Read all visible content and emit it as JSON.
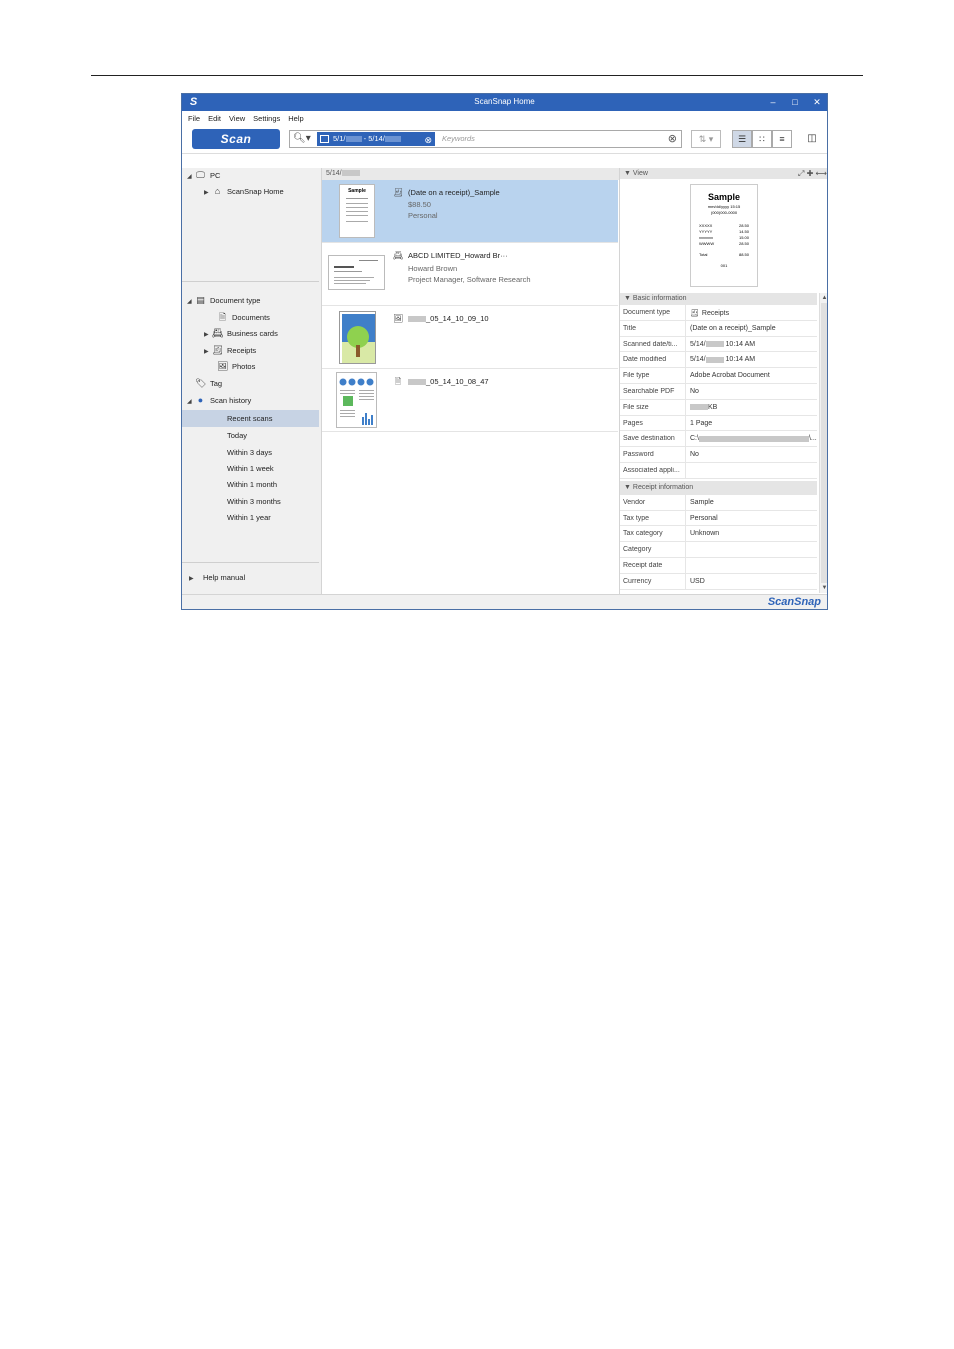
{
  "window": {
    "title": "ScanSnap Home",
    "controls": {
      "minimize": "–",
      "maximize": "□",
      "close": "✕"
    }
  },
  "menu": [
    "File",
    "Edit",
    "View",
    "Settings",
    "Help"
  ],
  "toolbar": {
    "scan_label": "Scan",
    "date_from": "5/1/",
    "date_sep": " - ",
    "date_to": "5/14/",
    "keywords_placeholder": "Keywords"
  },
  "left_tree": {
    "pc": "PC",
    "scansnap_home": "ScanSnap Home",
    "document_type": "Document type",
    "documents": "Documents",
    "business_cards": "Business cards",
    "receipts": "Receipts",
    "photos": "Photos",
    "tag": "Tag",
    "scan_history": "Scan history",
    "history_items": [
      "Recent scans",
      "Today",
      "Within 3 days",
      "Within 1 week",
      "Within 1 month",
      "Within 3 months",
      "Within 1 year"
    ],
    "selected_history": "Recent scans",
    "help_manual": "Help manual"
  },
  "content_list": {
    "date_header": "5/14/",
    "items": [
      {
        "title": "(Date on a receipt)_Sample",
        "line2": "$88.50",
        "line3": "Personal",
        "type": "receipt"
      },
      {
        "title": "ABCD LIMITED_Howard Br···",
        "line2": "Howard Brown",
        "line3": "Project Manager, Software Research",
        "type": "business-card"
      },
      {
        "title": "_05_14_10_09_10",
        "type": "photo"
      },
      {
        "title": "_05_14_10_08_47",
        "type": "document"
      }
    ]
  },
  "preview": {
    "section_label": "View",
    "thumb_title": "Sample",
    "thumb_date": "mm/dd/yyyy 15:15",
    "thumb_code": "(000)000-0000",
    "thumb_lines": [
      [
        "XXXXX",
        "28.50"
      ],
      [
        "YYYYY",
        "14.50"
      ],
      [
        "xxxxxxx",
        "15.00"
      ],
      [
        "WWWW",
        "28.50"
      ]
    ],
    "thumb_total_label": "Total",
    "thumb_total": "88.50",
    "thumb_footer": "001"
  },
  "basic_info": {
    "section_label": "Basic information",
    "rows": [
      {
        "label": "Document type",
        "value": "Receipts"
      },
      {
        "label": "Title",
        "value": "(Date on a receipt)_Sample"
      },
      {
        "label": "Scanned date/ti...",
        "value": "5/14/",
        "value2": "10:14 AM"
      },
      {
        "label": "Date modified",
        "value": "5/14/",
        "value2": "10:14 AM"
      },
      {
        "label": "File type",
        "value": "Adobe Acrobat Document"
      },
      {
        "label": "Searchable PDF",
        "value": "No"
      },
      {
        "label": "File size",
        "value": "KB"
      },
      {
        "label": "Pages",
        "value": "1 Page"
      },
      {
        "label": "Save destination",
        "value": "C:\\",
        "value2": "\\..."
      },
      {
        "label": "Password",
        "value": "No"
      },
      {
        "label": "Associated appli...",
        "value": ""
      }
    ]
  },
  "receipt_info": {
    "section_label": "Receipt information",
    "rows": [
      {
        "label": "Vendor",
        "value": "Sample"
      },
      {
        "label": "Tax type",
        "value": "Personal"
      },
      {
        "label": "Tax category",
        "value": "Unknown"
      },
      {
        "label": "Category",
        "value": ""
      },
      {
        "label": "Receipt date",
        "value": ""
      },
      {
        "label": "Currency",
        "value": "USD"
      }
    ]
  },
  "status": {
    "brand": "ScanSnap"
  }
}
